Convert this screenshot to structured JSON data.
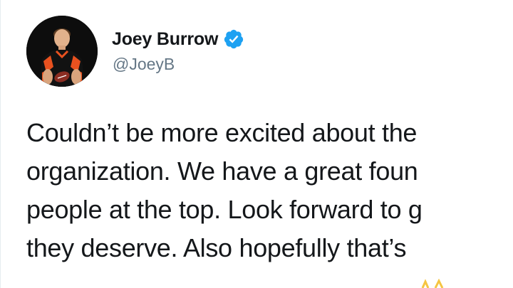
{
  "tweet": {
    "author": {
      "display_name": "Joey Burrow",
      "handle": "@JoeyB",
      "verified": true,
      "verified_color": "#1da1f2",
      "avatar_icon": "profile-photo"
    },
    "text_lines": [
      "Couldn’t be more excited about the",
      "organization. We have a great foun",
      "people at the top. Look forward to g",
      "they deserve. Also hopefully that’s"
    ]
  }
}
